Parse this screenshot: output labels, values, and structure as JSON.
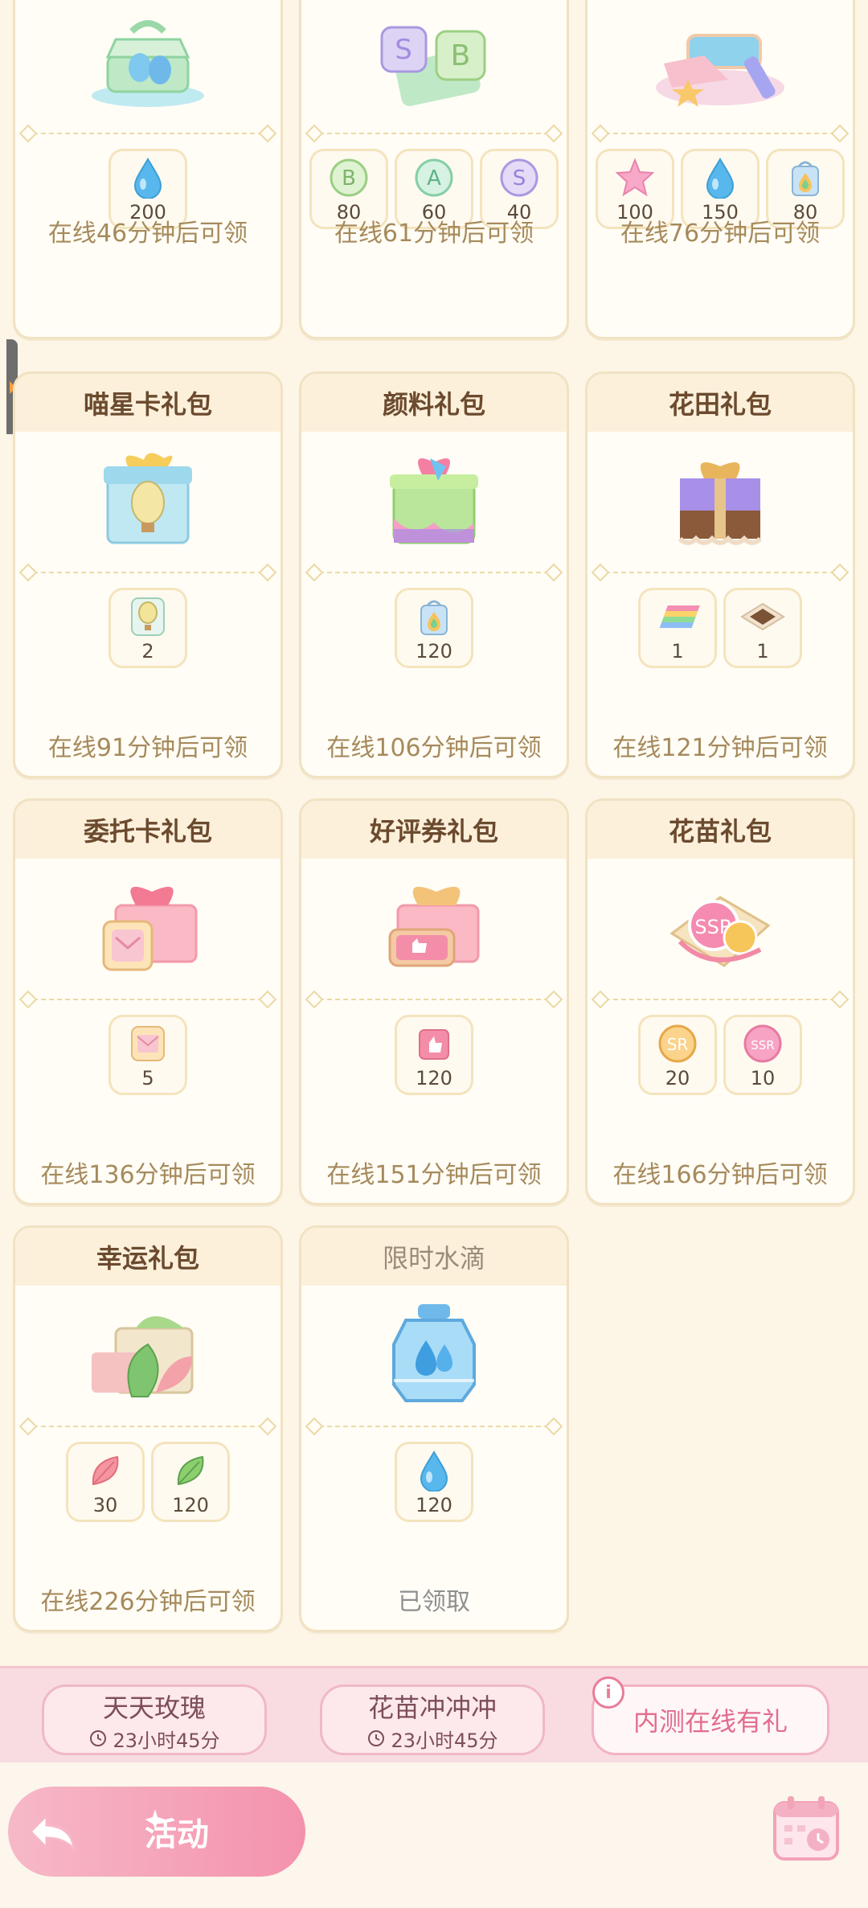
{
  "cards": [
    {
      "title": "",
      "items": [
        {
          "icon": "water-drop-icon",
          "qty": "200"
        }
      ],
      "footer": "在线46分钟后可领"
    },
    {
      "title": "",
      "items": [
        {
          "icon": "badge-b-icon",
          "qty": "80"
        },
        {
          "icon": "badge-a-icon",
          "qty": "60"
        },
        {
          "icon": "badge-s-icon",
          "qty": "40"
        }
      ],
      "footer": "在线61分钟后可领"
    },
    {
      "title": "",
      "items": [
        {
          "icon": "star-icon",
          "qty": "100"
        },
        {
          "icon": "water-drop-icon",
          "qty": "150"
        },
        {
          "icon": "paint-bag-icon",
          "qty": "80"
        }
      ],
      "footer": "在线76分钟后可领"
    },
    {
      "title": "喵星卡礼包",
      "items": [
        {
          "icon": "balloon-card-icon",
          "qty": "2"
        }
      ],
      "footer": "在线91分钟后可领"
    },
    {
      "title": "颜料礼包",
      "items": [
        {
          "icon": "paint-bag-icon",
          "qty": "120"
        }
      ],
      "footer": "在线106分钟后可领"
    },
    {
      "title": "花田礼包",
      "items": [
        {
          "icon": "rainbow-block-icon",
          "qty": "1"
        },
        {
          "icon": "soil-tile-icon",
          "qty": "1"
        }
      ],
      "footer": "在线121分钟后可领"
    },
    {
      "title": "委托卡礼包",
      "items": [
        {
          "icon": "envelope-card-icon",
          "qty": "5"
        }
      ],
      "footer": "在线136分钟后可领"
    },
    {
      "title": "好评券礼包",
      "items": [
        {
          "icon": "thumbs-up-card-icon",
          "qty": "120"
        }
      ],
      "footer": "在线151分钟后可领"
    },
    {
      "title": "花苗礼包",
      "items": [
        {
          "icon": "sr-seed-icon",
          "qty": "20"
        },
        {
          "icon": "ssr-seed-icon",
          "qty": "10"
        }
      ],
      "footer": "在线166分钟后可领"
    },
    {
      "title": "幸运礼包",
      "items": [
        {
          "icon": "red-leaf-icon",
          "qty": "30"
        },
        {
          "icon": "green-leaf-icon",
          "qty": "120"
        }
      ],
      "footer": "在线226分钟后可领"
    },
    {
      "title": "限时水滴",
      "items": [
        {
          "icon": "water-drop-icon",
          "qty": "120"
        }
      ],
      "footer": "已领取"
    }
  ],
  "tabs": [
    {
      "label": "天天玫瑰",
      "timer": "23小时45分"
    },
    {
      "label": "花苗冲冲冲",
      "timer": "23小时45分"
    },
    {
      "label": "内测在线有礼"
    }
  ],
  "info_badge": "i",
  "nav": {
    "activity_label": "活动"
  },
  "colors": {
    "accent_pink": "#f492ad",
    "card_border": "#f1e2c3",
    "footer_text": "#a68a5c"
  }
}
